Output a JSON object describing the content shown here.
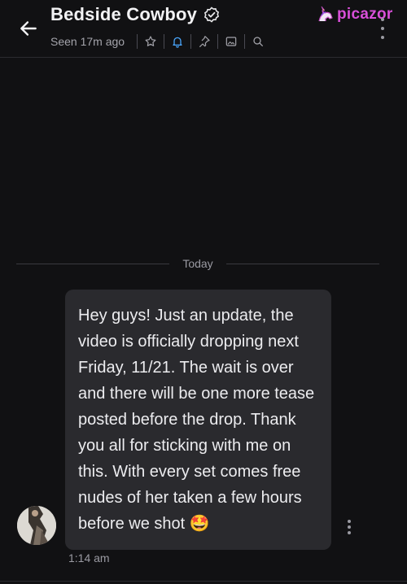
{
  "header": {
    "title": "Bedside Cowboy",
    "seen": "Seen 17m ago",
    "icons": [
      "star-icon",
      "bell-icon",
      "pin-icon",
      "image-icon",
      "search-icon"
    ],
    "accent_color": "#4aa8ff"
  },
  "watermark": {
    "text": "picazor"
  },
  "divider": {
    "label": "Today"
  },
  "message": {
    "text": "Hey guys! Just an update, the video is officially dropping next Friday, 11/21. The wait is over and there will be one more tease posted before the drop. Thank you all for sticking with me on this. With every set comes free nudes of her taken a few hours before we shot 🤩",
    "time": "1:14 am"
  }
}
